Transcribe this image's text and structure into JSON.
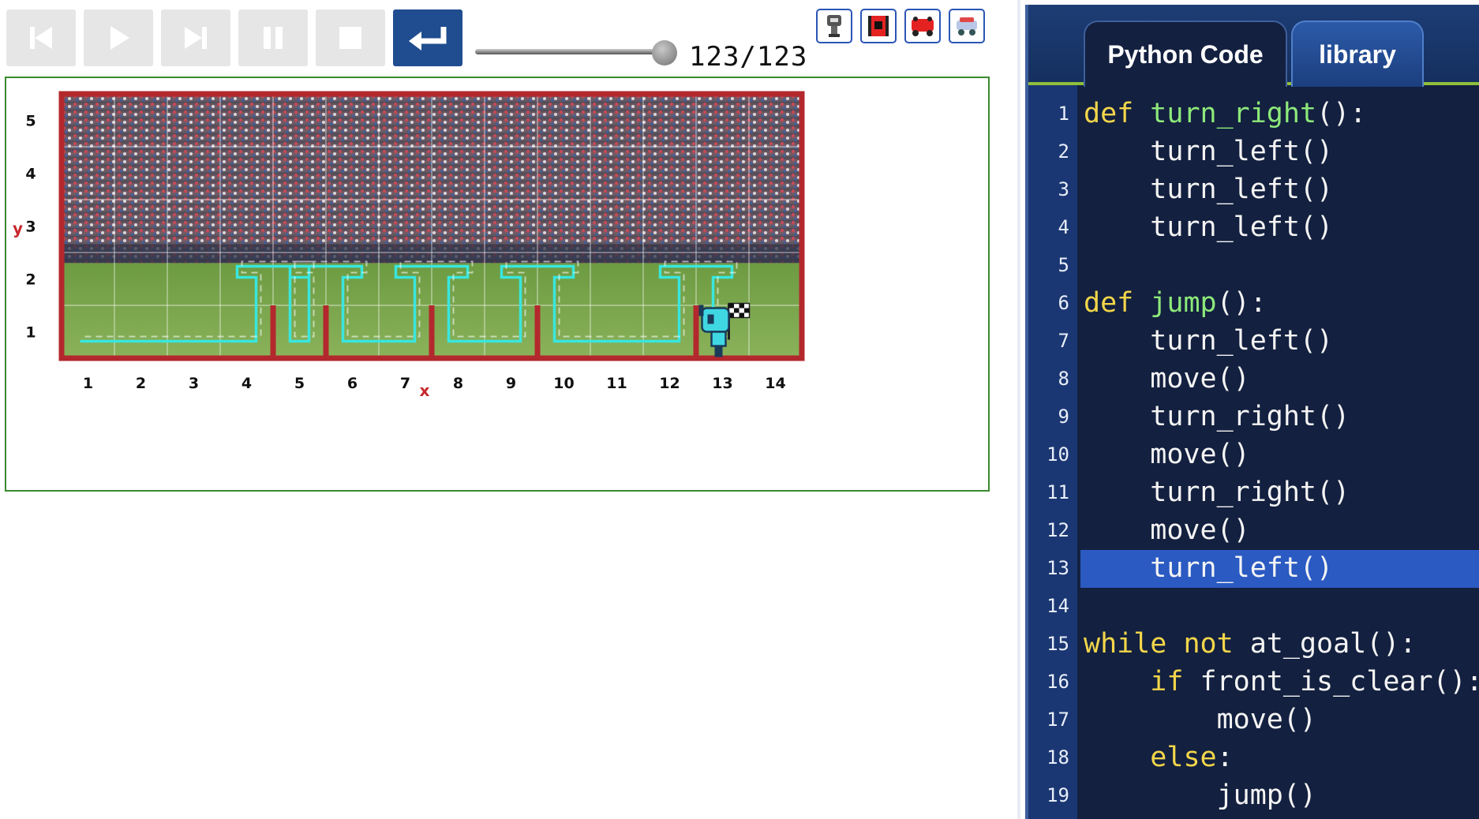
{
  "toolbar": {
    "buttons": [
      {
        "name": "skip-to-start-button",
        "icon": "skip-back-icon"
      },
      {
        "name": "play-button",
        "icon": "play-icon"
      },
      {
        "name": "step-forward-button",
        "icon": "step-forward-icon"
      },
      {
        "name": "pause-button",
        "icon": "pause-icon"
      },
      {
        "name": "stop-button",
        "icon": "stop-icon"
      },
      {
        "name": "return-button",
        "icon": "return-arrow-icon",
        "active": true
      }
    ],
    "step_counter": "123/123",
    "slider_fraction": 1.0,
    "robot_selectors": [
      "gray-robot-icon",
      "red-tracked-robot-icon",
      "red-car-robot-icon",
      "blue-rover-robot-icon"
    ]
  },
  "world": {
    "x_label": "x",
    "y_label": "y",
    "x_ticks": [
      "1",
      "2",
      "3",
      "4",
      "5",
      "6",
      "7",
      "8",
      "9",
      "10",
      "11",
      "12",
      "13",
      "14"
    ],
    "y_ticks": [
      "1",
      "2",
      "3",
      "4",
      "5"
    ],
    "robot_position": {
      "x": 13,
      "y": 1
    },
    "goal_position": {
      "x": 13,
      "y": 1
    },
    "wall_after_columns": [
      4,
      5,
      7,
      9,
      12
    ],
    "trace_color": "#39e6de",
    "wall_color": "#b3282d",
    "grass_color": "#5f8f3a"
  },
  "code_panel": {
    "tabs": [
      {
        "label": "Python Code",
        "active": true
      },
      {
        "label": "library",
        "active": false
      }
    ],
    "highlighted_line": 13,
    "lines": [
      {
        "num": "1",
        "tokens": [
          {
            "t": "def",
            "c": "kw"
          },
          {
            "t": " "
          },
          {
            "t": "turn_right",
            "c": "fn"
          },
          {
            "t": "():"
          }
        ]
      },
      {
        "num": "2",
        "tokens": [
          {
            "t": "    turn_left()"
          }
        ]
      },
      {
        "num": "3",
        "tokens": [
          {
            "t": "    turn_left()"
          }
        ]
      },
      {
        "num": "4",
        "tokens": [
          {
            "t": "    turn_left()"
          }
        ]
      },
      {
        "num": "5",
        "tokens": []
      },
      {
        "num": "6",
        "tokens": [
          {
            "t": "def",
            "c": "kw"
          },
          {
            "t": " "
          },
          {
            "t": "jump",
            "c": "fn"
          },
          {
            "t": "():"
          }
        ]
      },
      {
        "num": "7",
        "tokens": [
          {
            "t": "    turn_left()"
          }
        ]
      },
      {
        "num": "8",
        "tokens": [
          {
            "t": "    move()"
          }
        ]
      },
      {
        "num": "9",
        "tokens": [
          {
            "t": "    turn_right()"
          }
        ]
      },
      {
        "num": "10",
        "tokens": [
          {
            "t": "    move()"
          }
        ]
      },
      {
        "num": "11",
        "tokens": [
          {
            "t": "    turn_right()"
          }
        ]
      },
      {
        "num": "12",
        "tokens": [
          {
            "t": "    move()"
          }
        ]
      },
      {
        "num": "13",
        "tokens": [
          {
            "t": "    turn_left()"
          }
        ]
      },
      {
        "num": "14",
        "tokens": []
      },
      {
        "num": "15",
        "tokens": [
          {
            "t": "while",
            "c": "kw"
          },
          {
            "t": " "
          },
          {
            "t": "not",
            "c": "kw"
          },
          {
            "t": " at_goal():"
          }
        ]
      },
      {
        "num": "16",
        "tokens": [
          {
            "t": "    "
          },
          {
            "t": "if",
            "c": "kw"
          },
          {
            "t": " front_is_clear():"
          }
        ]
      },
      {
        "num": "17",
        "tokens": [
          {
            "t": "        move()"
          }
        ]
      },
      {
        "num": "18",
        "tokens": [
          {
            "t": "    "
          },
          {
            "t": "else",
            "c": "kw"
          },
          {
            "t": ":"
          }
        ]
      },
      {
        "num": "19",
        "tokens": [
          {
            "t": "        jump()"
          }
        ]
      }
    ]
  }
}
